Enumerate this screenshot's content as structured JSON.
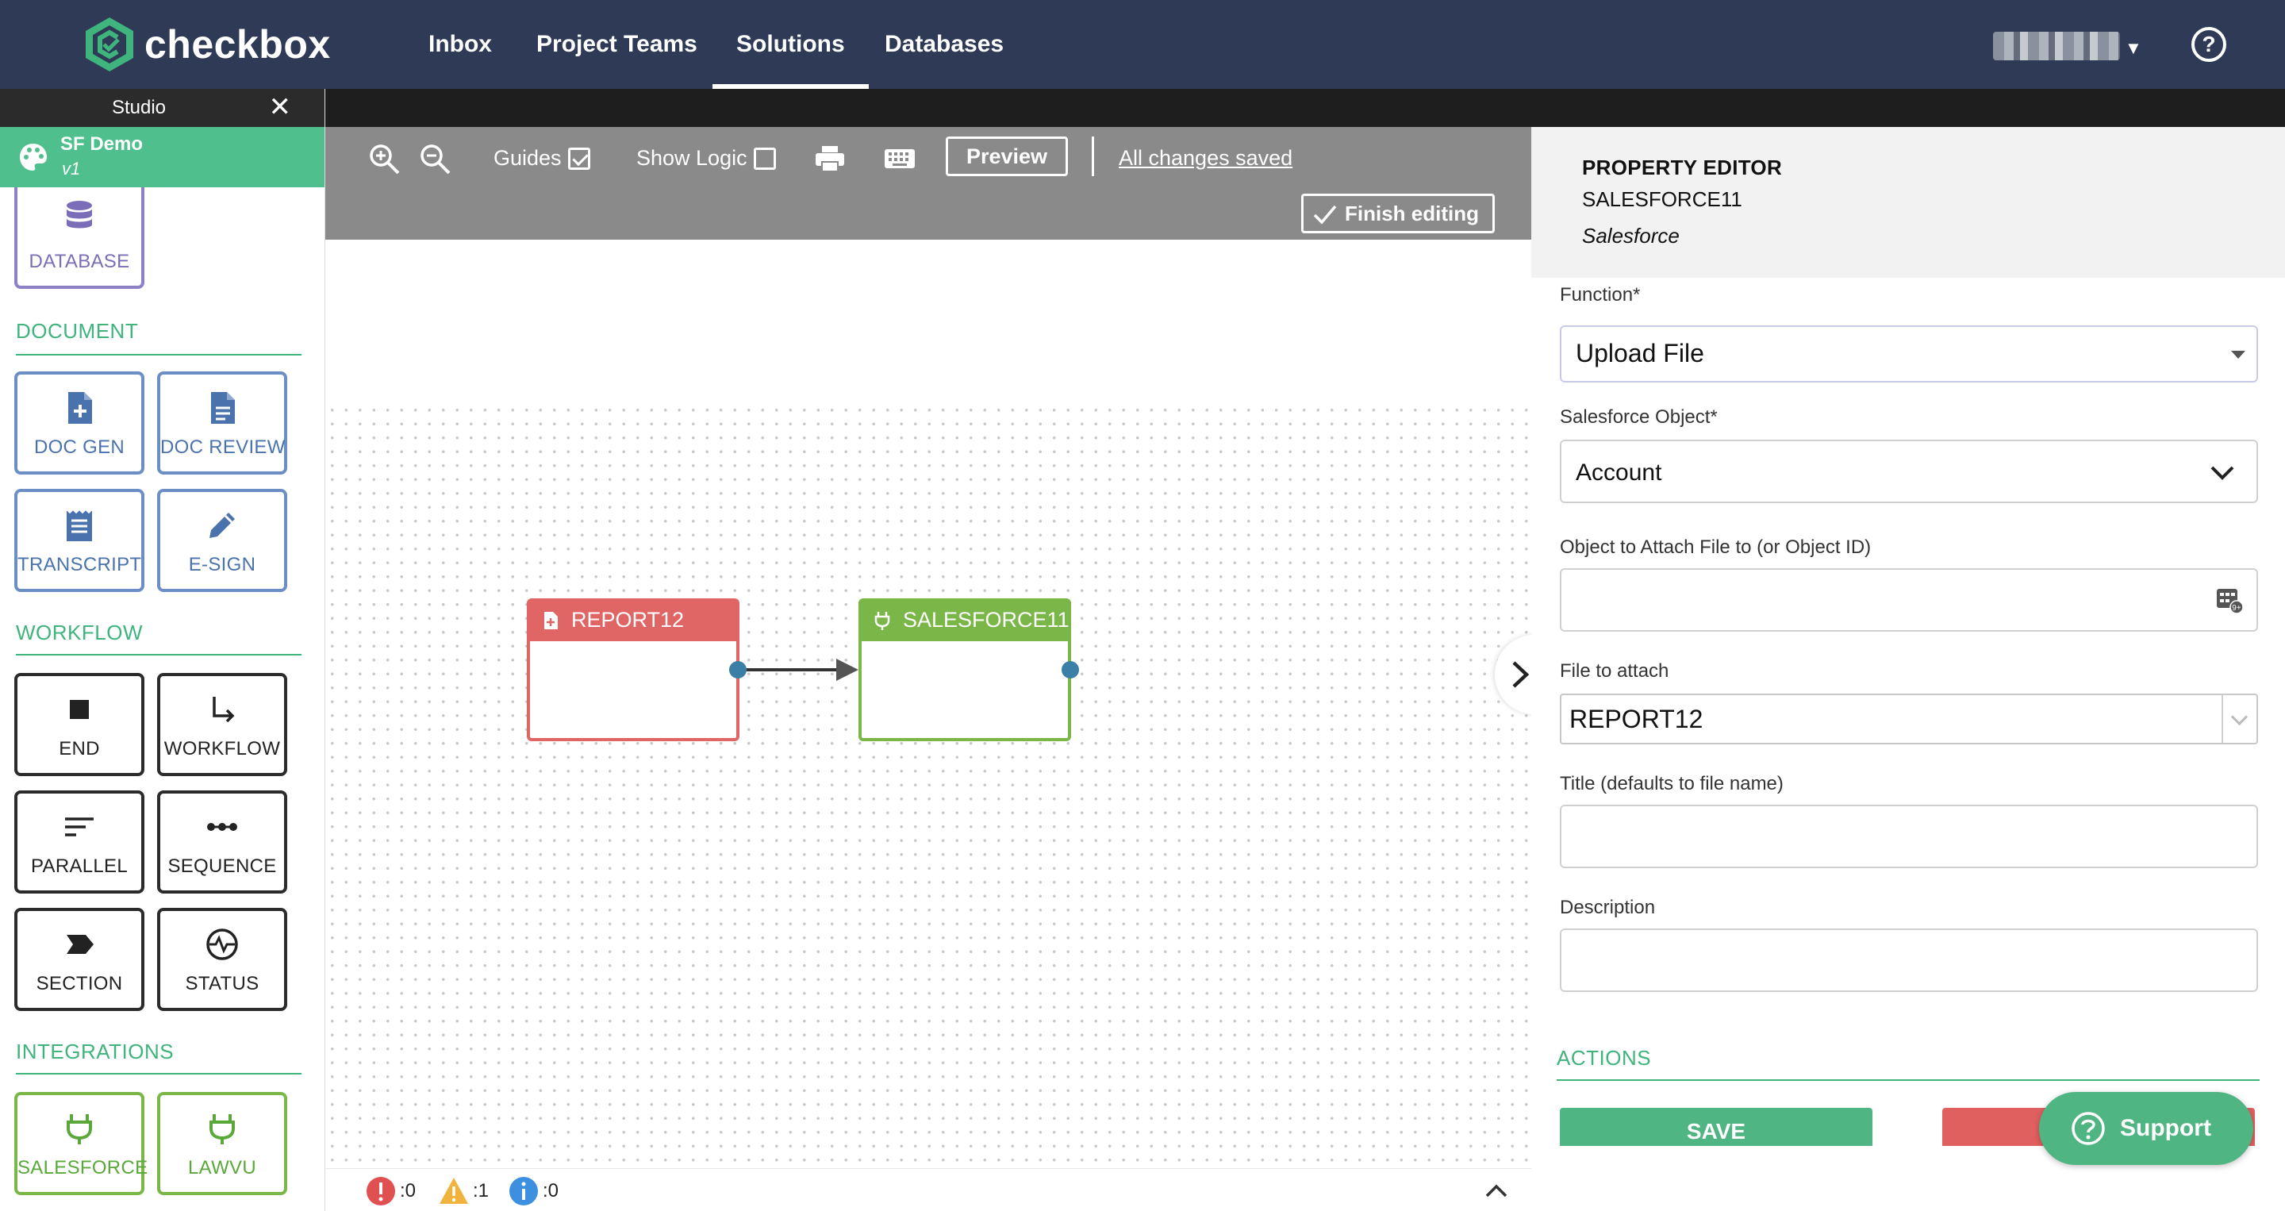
{
  "app": {
    "name": "checkbox"
  },
  "nav": {
    "items": [
      {
        "label": "Inbox"
      },
      {
        "label": "Project Teams"
      },
      {
        "label": "Solutions"
      },
      {
        "label": "Databases"
      }
    ],
    "active": "Solutions"
  },
  "sidebar": {
    "studio_title": "Studio",
    "project_name": "SF Demo",
    "project_version": "v1",
    "database_tile": "DATABASE",
    "sections": {
      "document": "DOCUMENT",
      "workflow": "WORKFLOW",
      "integrations": "INTEGRATIONS"
    },
    "document_tiles": [
      "DOC GEN",
      "DOC REVIEW",
      "TRANSCRIPT",
      "E-SIGN"
    ],
    "workflow_tiles": [
      "END",
      "WORKFLOW",
      "PARALLEL",
      "SEQUENCE",
      "SECTION",
      "STATUS"
    ],
    "integration_tiles": [
      "SALESFORCE",
      "LAWVU"
    ]
  },
  "toolbar": {
    "guides_label": "Guides",
    "guides_checked": true,
    "show_logic_label": "Show Logic",
    "show_logic_checked": false,
    "preview_label": "Preview",
    "saved_status": "All changes saved",
    "finish_label": "Finish editing"
  },
  "canvas": {
    "nodes": [
      {
        "label": "REPORT12",
        "type": "report",
        "color": "#e06666"
      },
      {
        "label": "SALESFORCE11",
        "type": "salesforce",
        "color": "#7ab648"
      }
    ]
  },
  "status": {
    "errors": ":0",
    "warnings": ":1",
    "info": ":0"
  },
  "property_editor": {
    "title": "PROPERTY EDITOR",
    "name": "SALESFORCE11",
    "type": "Salesforce",
    "function_label": "Function*",
    "function_value": "Upload File",
    "object_label": "Salesforce Object*",
    "object_value": "Account",
    "attach_to_label": "Object to Attach File to (or Object ID)",
    "attach_to_value": "",
    "file_label": "File to attach",
    "file_value": "REPORT12",
    "title_label": "Title (defaults to file name)",
    "title_value": "",
    "description_label": "Description",
    "description_value": "",
    "actions_label": "ACTIONS",
    "save_label": "SAVE"
  },
  "support": {
    "label": "Support"
  },
  "colors": {
    "nav_bg": "#2e3a56",
    "brand_green": "#4fc08d",
    "action_green": "#4fb582",
    "danger_red": "#e06060",
    "tile_blue": "#5b7fb0"
  }
}
